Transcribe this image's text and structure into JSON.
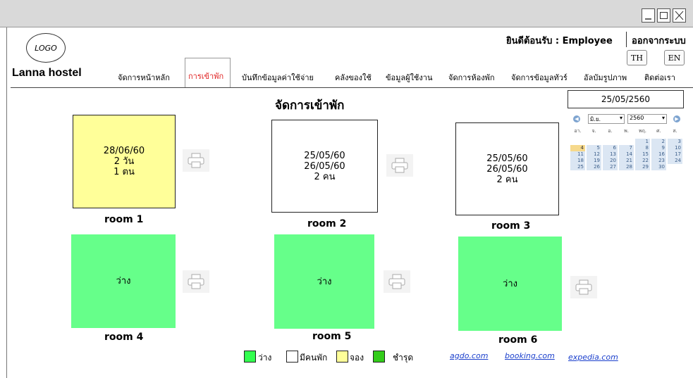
{
  "window": {
    "controls": [
      "_",
      "□",
      "X"
    ]
  },
  "header": {
    "logo": "LOGO",
    "brand": "Lanna hostel",
    "welcome": "ยินดีต้อนรับ : Employee",
    "logout": "ออกจากระบบ",
    "lang": [
      "TH",
      "EN"
    ]
  },
  "nav": {
    "items": [
      "จัดการหน้าหลัก",
      "การเข้าพัก",
      "บันทึกข้อมูลค่าใช้จ่าย",
      "คลังของใช้",
      "ข้อมูลผู้ใช้งาน",
      "จัดการห้องพัก",
      "จัดการข้อมูลทัวร์",
      "อัลบัมรูปภาพ",
      "ติดต่อเรา"
    ],
    "active_index": 1
  },
  "page": {
    "title": "จัดการเข้าพัก",
    "date": "25/05/2560"
  },
  "calendar": {
    "month": "มิ.ย.",
    "year": "2560",
    "weekdays": [
      "อา.",
      "จ.",
      "อ.",
      "พ.",
      "พฤ.",
      "ศ.",
      "ส."
    ],
    "weeks": [
      [
        "",
        "",
        "",
        "",
        "1",
        "2",
        "3"
      ],
      [
        "4",
        "5",
        "6",
        "7",
        "8",
        "9",
        "10"
      ],
      [
        "11",
        "12",
        "13",
        "14",
        "15",
        "16",
        "17"
      ],
      [
        "18",
        "19",
        "20",
        "21",
        "22",
        "23",
        "24"
      ],
      [
        "25",
        "26",
        "27",
        "28",
        "29",
        "30",
        ""
      ]
    ],
    "today": "4"
  },
  "rooms": [
    {
      "label": "room 1",
      "status": "booked",
      "lines": [
        "28/06/60",
        "2 วัน",
        "1 ตน"
      ]
    },
    {
      "label": "room 2",
      "status": "occupied",
      "lines": [
        "25/05/60",
        "26/05/60",
        "2 คน"
      ]
    },
    {
      "label": "room 3",
      "status": "occupied",
      "lines": [
        "25/05/60",
        "26/05/60",
        "2 คน"
      ]
    },
    {
      "label": "room 4",
      "status": "vacant",
      "lines": [
        "ว่าง"
      ]
    },
    {
      "label": "room 5",
      "status": "vacant",
      "lines": [
        "ว่าง"
      ]
    },
    {
      "label": "room 6",
      "status": "vacant",
      "lines": [
        "ว่าง"
      ]
    }
  ],
  "legend": [
    {
      "label": "ว่าง",
      "color": "#33ff4f"
    },
    {
      "label": "มีคนพัก",
      "color": "#ffffff"
    },
    {
      "label": "จอง",
      "color": "#ffff99"
    },
    {
      "label": "ชำรุด",
      "color": "#33cc1a"
    }
  ],
  "links": [
    "agdo.com",
    "booking.com",
    "expedia.com"
  ]
}
